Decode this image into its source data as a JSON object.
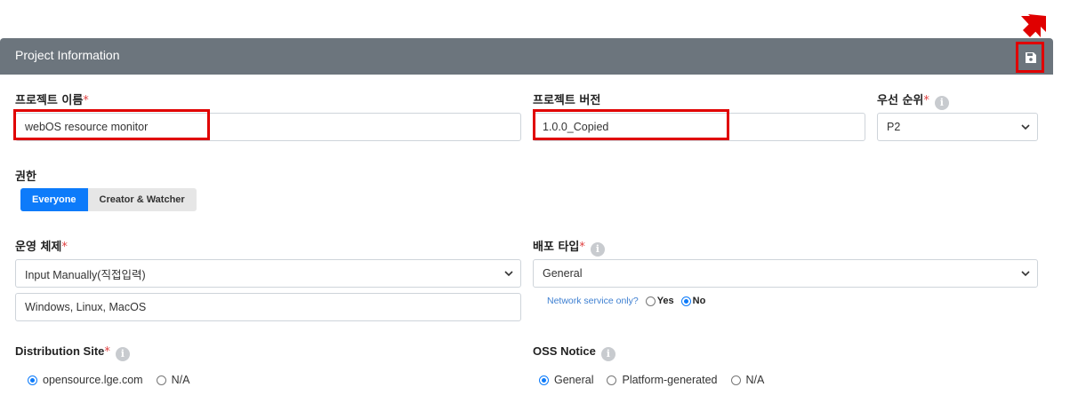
{
  "panel": {
    "title": "Project Information"
  },
  "project_name": {
    "label": "프로젝트 이름",
    "required": "*",
    "value": "webOS resource monitor"
  },
  "project_version": {
    "label": "프로젝트 버전",
    "value": "1.0.0_Copied"
  },
  "priority": {
    "label": "우선 순위",
    "required": "*",
    "info": "i",
    "value": "P2"
  },
  "permission": {
    "label": "권한",
    "options": [
      "Everyone",
      "Creator & Watcher"
    ]
  },
  "os": {
    "label": "운영 체제",
    "required": "*",
    "select_value": "Input Manually(직접입력)",
    "text_value": "Windows, Linux, MacOS"
  },
  "distribution_type": {
    "label": "배포 타입",
    "required": "*",
    "info": "i",
    "value": "General",
    "network_label": "Network service only?",
    "yes": "Yes",
    "no": "No"
  },
  "distribution_site": {
    "label": "Distribution Site",
    "required": "*",
    "info": "i",
    "options": [
      "opensource.lge.com",
      "N/A"
    ]
  },
  "oss_notice": {
    "label": "OSS Notice",
    "info": "i",
    "options": [
      "General",
      "Platform-generated",
      "N/A"
    ]
  },
  "icons": {
    "save": "floppy-disk-icon",
    "info": "info-circle-icon",
    "chevron": "chevron-down-icon"
  },
  "colors": {
    "header": "#6c757d",
    "accent": "#0d7bfa",
    "highlight": "#e00000"
  }
}
